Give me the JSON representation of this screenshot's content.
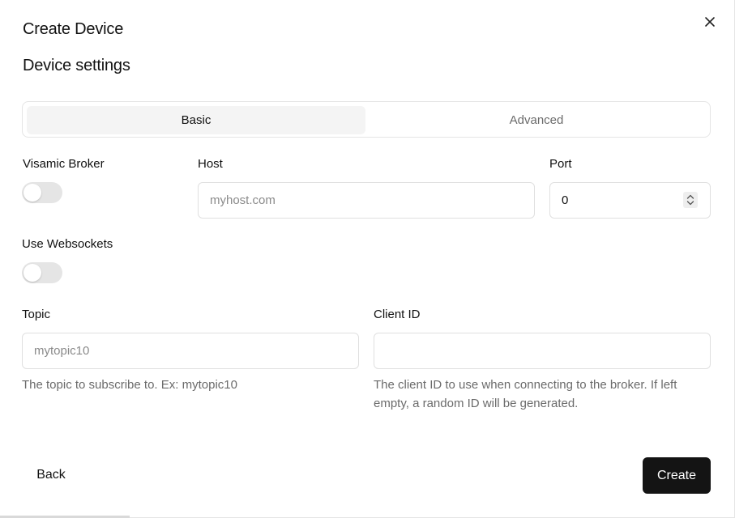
{
  "dialog": {
    "title": "Create Device",
    "close_icon": "close-icon"
  },
  "section": {
    "title": "Device settings"
  },
  "tabs": [
    {
      "label": "Basic",
      "active": true
    },
    {
      "label": "Advanced",
      "active": false
    }
  ],
  "form": {
    "visamic_broker": {
      "label": "Visamic Broker",
      "enabled": false
    },
    "host": {
      "label": "Host",
      "placeholder": "myhost.com",
      "value": ""
    },
    "port": {
      "label": "Port",
      "value": "0"
    },
    "use_websockets": {
      "label": "Use Websockets",
      "enabled": false
    },
    "topic": {
      "label": "Topic",
      "placeholder": "mytopic10",
      "value": "",
      "help": "The topic to subscribe to. Ex: mytopic10"
    },
    "client_id": {
      "label": "Client ID",
      "placeholder": "",
      "value": "",
      "help": "The client ID to use when connecting to the broker. If left empty, a random ID will be generated."
    }
  },
  "footer": {
    "back_label": "Back",
    "create_label": "Create"
  },
  "colors": {
    "primary_button": "#141414",
    "toggle_off": "#e5e5e5",
    "muted_text": "#6b6b6b"
  }
}
